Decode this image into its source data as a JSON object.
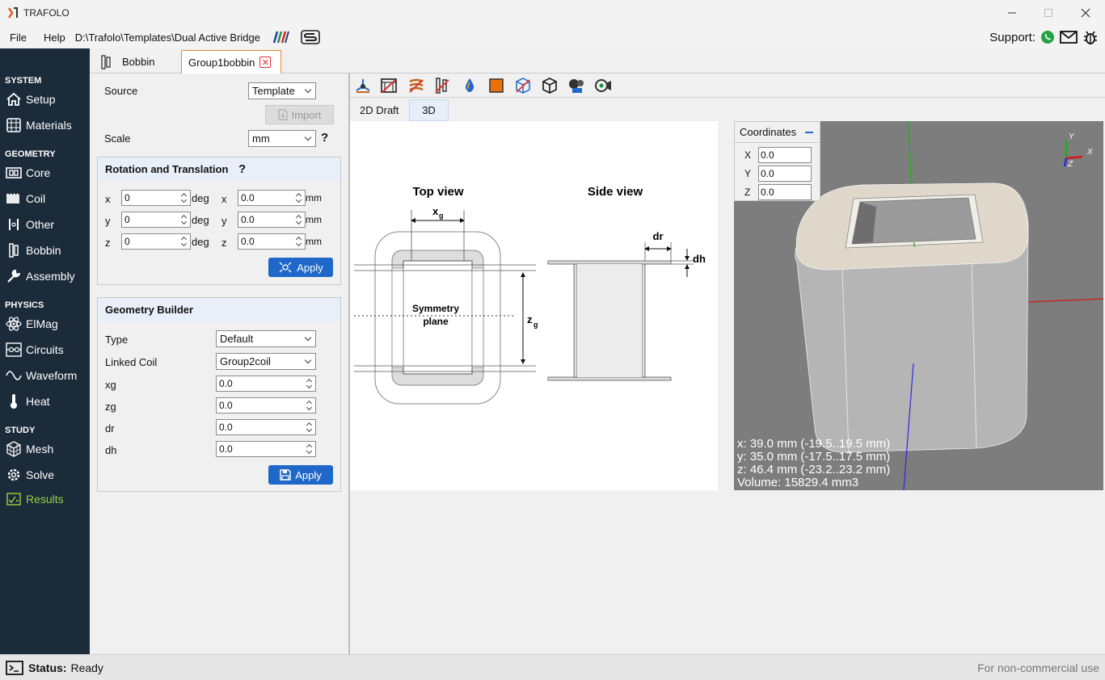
{
  "window": {
    "title": "TRAFOLO"
  },
  "menu": {
    "file": "File",
    "help": "Help",
    "path": "D:\\Trafolo\\Templates\\Dual Active Bridge",
    "support_label": "Support:"
  },
  "sidebar": {
    "system": "SYSTEM",
    "geometry": "GEOMETRY",
    "physics": "PHYSICS",
    "study": "STUDY",
    "items": {
      "setup": "Setup",
      "materials": "Materials",
      "core": "Core",
      "coil": "Coil",
      "other": "Other",
      "bobbin": "Bobbin",
      "assembly": "Assembly",
      "elmag": "ElMag",
      "circuits": "Circuits",
      "waveform": "Waveform",
      "heat": "Heat",
      "mesh": "Mesh",
      "solve": "Solve",
      "results": "Results"
    }
  },
  "tabs": {
    "bobbin": "Bobbin",
    "group1bobbin": "Group1bobbin"
  },
  "source": {
    "label": "Source",
    "value": "Template",
    "import": "Import"
  },
  "scale": {
    "label": "Scale",
    "value": "mm",
    "help": "?"
  },
  "rotation": {
    "title": "Rotation and Translation",
    "help": "?",
    "rx": "0",
    "ry": "0",
    "rz": "0",
    "tx": "0.0",
    "ty": "0.0",
    "tz": "0.0",
    "x": "x",
    "y": "y",
    "z": "z",
    "deg": "deg",
    "mm": "mm",
    "apply": "Apply"
  },
  "builder": {
    "title": "Geometry Builder",
    "type_label": "Type",
    "type_value": "Default",
    "coil_label": "Linked Coil",
    "coil_value": "Group2coil",
    "xg_label": "xg",
    "xg": "0.0",
    "zg_label": "zg",
    "zg": "0.0",
    "dr_label": "dr",
    "dr": "0.0",
    "dh_label": "dh",
    "dh": "0.0",
    "apply": "Apply"
  },
  "viewtabs": {
    "draft": "2D Draft",
    "v3d": "3D"
  },
  "draft": {
    "top_view": "Top view",
    "side_view": "Side view",
    "xg": "x",
    "xg_sub": "g",
    "zg": "z",
    "zg_sub": "g",
    "dr": "dr",
    "dh": "dh",
    "sym1": "Symmetry",
    "sym2": "plane"
  },
  "coords": {
    "title": "Coordinates",
    "X": "0.0",
    "Y": "0.0",
    "Z": "0.0",
    "xl": "X",
    "yl": "Y",
    "zl": "Z"
  },
  "view3d": {
    "x": "x: 39.0 mm (-19.5..19.5 mm)",
    "y": "y: 35.0 mm (-17.5..17.5 mm)",
    "z": "z: 46.4 mm (-23.2..23.2 mm)",
    "volume": "Volume: 15829.4 mm3",
    "axis_x": "X",
    "axis_y": "Y",
    "axis_z": "Z"
  },
  "status": {
    "label": "Status:",
    "value": "Ready",
    "license": "For non-commercial use"
  },
  "colors": {
    "sidebar": "#1b2b3a",
    "accent": "#1f68c9",
    "active": "#9ad13c"
  }
}
